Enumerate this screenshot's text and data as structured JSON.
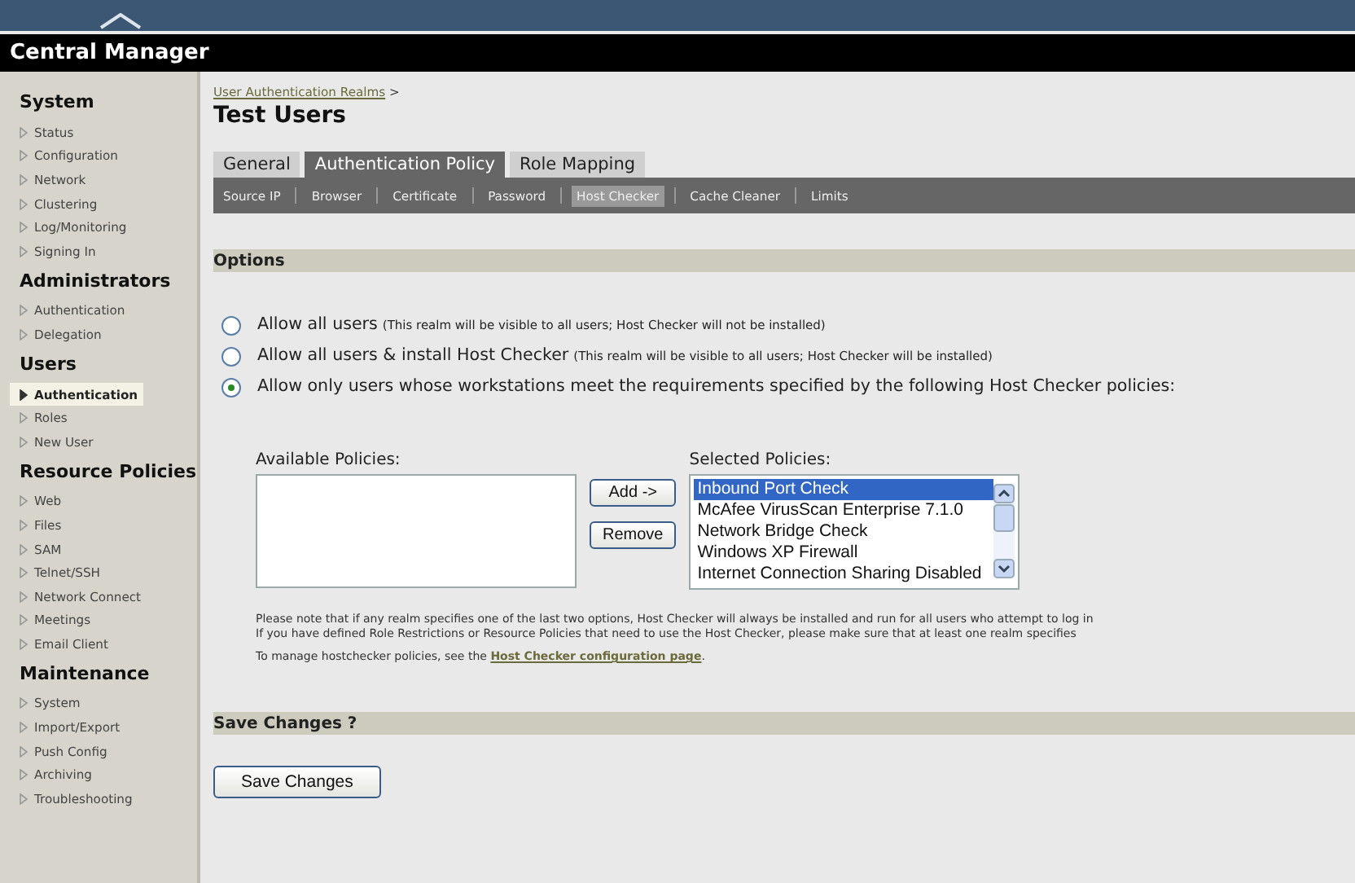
{
  "app_title": "Central Manager",
  "sidebar": [
    {
      "heading": "System",
      "items": [
        {
          "label": "Status",
          "selected": false
        },
        {
          "label": "Configuration",
          "selected": false
        },
        {
          "label": "Network",
          "selected": false
        },
        {
          "label": "Clustering",
          "selected": false
        },
        {
          "label": "Log/Monitoring",
          "selected": false
        },
        {
          "label": "Signing In",
          "selected": false
        }
      ]
    },
    {
      "heading": "Administrators",
      "items": [
        {
          "label": "Authentication",
          "selected": false
        },
        {
          "label": "Delegation",
          "selected": false
        }
      ]
    },
    {
      "heading": "Users",
      "items": [
        {
          "label": "Authentication",
          "selected": true
        },
        {
          "label": "Roles",
          "selected": false
        },
        {
          "label": "New User",
          "selected": false
        }
      ]
    },
    {
      "heading": "Resource Policies",
      "items": [
        {
          "label": "Web",
          "selected": false
        },
        {
          "label": "Files",
          "selected": false
        },
        {
          "label": "SAM",
          "selected": false
        },
        {
          "label": "Telnet/SSH",
          "selected": false
        },
        {
          "label": "Network Connect",
          "selected": false
        },
        {
          "label": "Meetings",
          "selected": false
        },
        {
          "label": "Email Client",
          "selected": false
        }
      ]
    },
    {
      "heading": "Maintenance",
      "items": [
        {
          "label": "System",
          "selected": false
        },
        {
          "label": "Import/Export",
          "selected": false
        },
        {
          "label": "Push Config",
          "selected": false
        },
        {
          "label": "Archiving",
          "selected": false
        },
        {
          "label": "Troubleshooting",
          "selected": false
        }
      ]
    }
  ],
  "breadcrumb": {
    "link": "User Authentication Realms",
    "separator": ">"
  },
  "page_title": "Test Users",
  "tabs": [
    {
      "label": "General",
      "selected": false
    },
    {
      "label": "Authentication Policy",
      "selected": true
    },
    {
      "label": "Role Mapping",
      "selected": false
    }
  ],
  "subtabs": [
    {
      "label": "Source IP",
      "selected": false
    },
    {
      "label": "Browser",
      "selected": false
    },
    {
      "label": "Certificate",
      "selected": false
    },
    {
      "label": "Password",
      "selected": false
    },
    {
      "label": "Host Checker",
      "selected": true
    },
    {
      "label": "Cache Cleaner",
      "selected": false
    },
    {
      "label": "Limits",
      "selected": false
    }
  ],
  "options_section": {
    "title": "Options",
    "options": [
      {
        "label": "Allow all users",
        "note": "(This realm will be visible to all users; Host Checker will not be installed)",
        "selected": false
      },
      {
        "label": "Allow all users & install Host Checker",
        "note": "(This realm will be visible to all users; Host Checker will be installed)",
        "selected": false
      },
      {
        "label": "Allow only users whose workstations meet the requirements specified by the following Host Checker policies:",
        "selected": true
      }
    ]
  },
  "available_policies": {
    "label": "Available Policies:"
  },
  "add_button": "Add ->",
  "remove_button": "Remove",
  "selected_policies": {
    "label": "Selected Policies:",
    "items": [
      {
        "label": "Inbound Port Check",
        "selected": true
      },
      {
        "label": "McAfee VirusScan Enterprise 7.1.0",
        "selected": false
      },
      {
        "label": "Network Bridge Check",
        "selected": false
      },
      {
        "label": "Windows XP Firewall",
        "selected": false
      },
      {
        "label": "Internet Connection Sharing Disabled",
        "selected": false
      }
    ]
  },
  "notes": [
    "Please note that if any realm specifies one of the last two options, Host Checker will always be installed and run for all users who attempt to log in",
    "If you have defined Role Restrictions or Resource Policies that need to use the Host Checker, please make sure that at least one realm specifies"
  ],
  "manage_note": {
    "text": "To manage hostchecker policies, see the",
    "link": "Host Checker configuration page",
    "end": "."
  },
  "save_section": {
    "title": "Save Changes ?",
    "button": "Save Changes"
  }
}
